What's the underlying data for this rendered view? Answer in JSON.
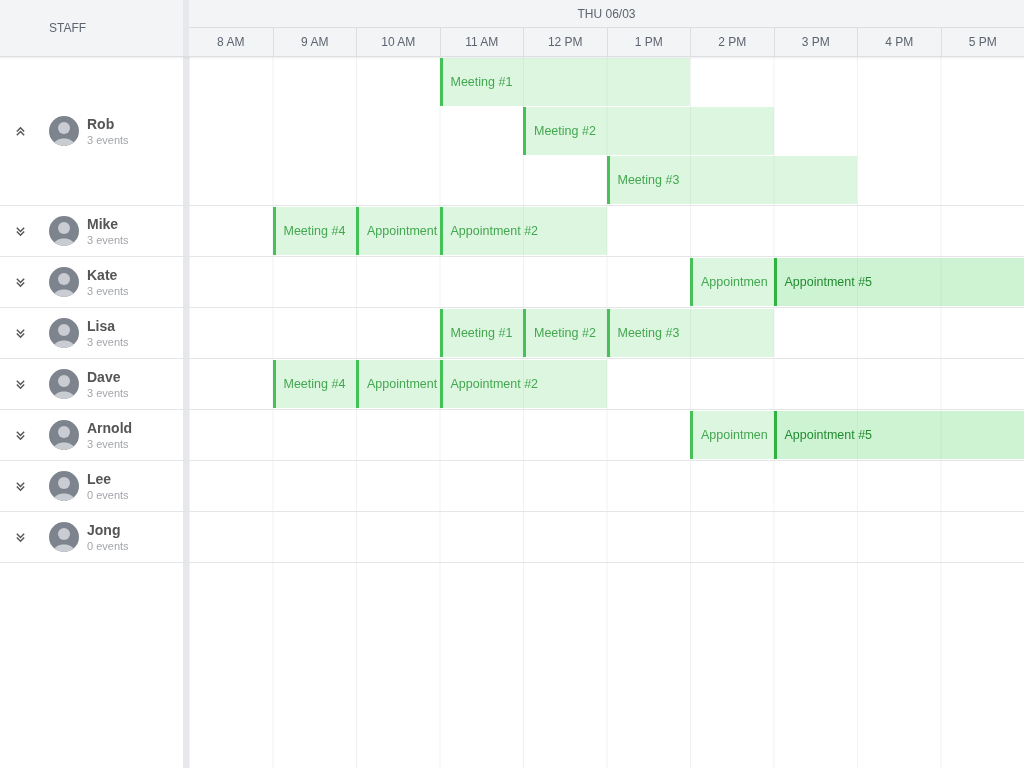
{
  "staff_header": "STAFF",
  "date": "THU 06/03",
  "hours": [
    "8 AM",
    "9 AM",
    "10 AM",
    "11 AM",
    "12 PM",
    "1 PM",
    "2 PM",
    "3 PM",
    "4 PM",
    "5 PM"
  ],
  "staff": [
    {
      "name": "Rob",
      "events_count": "3 events",
      "expanded": true,
      "lanes": [
        [
          {
            "kind": "empty"
          },
          {
            "kind": "empty"
          },
          {
            "kind": "empty"
          },
          {
            "kind": "event",
            "label": "Meeting #1",
            "highlighted": false
          },
          {
            "kind": "continued"
          },
          {
            "kind": "continued"
          },
          {
            "kind": "empty"
          },
          {
            "kind": "empty"
          },
          {
            "kind": "empty"
          },
          {
            "kind": "empty"
          }
        ],
        [
          {
            "kind": "empty"
          },
          {
            "kind": "empty"
          },
          {
            "kind": "empty"
          },
          {
            "kind": "empty"
          },
          {
            "kind": "event",
            "label": "Meeting #2",
            "highlighted": false
          },
          {
            "kind": "continued"
          },
          {
            "kind": "continued"
          },
          {
            "kind": "empty"
          },
          {
            "kind": "empty"
          },
          {
            "kind": "empty"
          }
        ],
        [
          {
            "kind": "empty"
          },
          {
            "kind": "empty"
          },
          {
            "kind": "empty"
          },
          {
            "kind": "empty"
          },
          {
            "kind": "empty"
          },
          {
            "kind": "event",
            "label": "Meeting #3",
            "highlighted": false
          },
          {
            "kind": "continued"
          },
          {
            "kind": "continued"
          },
          {
            "kind": "empty"
          },
          {
            "kind": "empty"
          }
        ]
      ]
    },
    {
      "name": "Mike",
      "events_count": "3 events",
      "expanded": false,
      "lanes": [
        [
          {
            "kind": "empty"
          },
          {
            "kind": "event",
            "label": "Meeting #4",
            "highlighted": false
          },
          {
            "kind": "event",
            "label": "Appointment",
            "highlighted": false
          },
          {
            "kind": "event",
            "label": "Appointment #2",
            "highlighted": false
          },
          {
            "kind": "continued"
          },
          {
            "kind": "empty"
          },
          {
            "kind": "empty"
          },
          {
            "kind": "empty"
          },
          {
            "kind": "empty"
          },
          {
            "kind": "empty"
          }
        ]
      ]
    },
    {
      "name": "Kate",
      "events_count": "3 events",
      "expanded": false,
      "lanes": [
        [
          {
            "kind": "empty"
          },
          {
            "kind": "empty"
          },
          {
            "kind": "empty"
          },
          {
            "kind": "empty"
          },
          {
            "kind": "empty"
          },
          {
            "kind": "empty"
          },
          {
            "kind": "event",
            "label": "Appointmen",
            "highlighted": false
          },
          {
            "kind": "event",
            "label": "Appointment #5",
            "highlighted": true
          },
          {
            "kind": "continued"
          },
          {
            "kind": "continued"
          }
        ]
      ]
    },
    {
      "name": "Lisa",
      "events_count": "3 events",
      "expanded": false,
      "lanes": [
        [
          {
            "kind": "empty"
          },
          {
            "kind": "empty"
          },
          {
            "kind": "empty"
          },
          {
            "kind": "event",
            "label": "Meeting #1",
            "highlighted": false
          },
          {
            "kind": "event",
            "label": "Meeting #2",
            "highlighted": false
          },
          {
            "kind": "event",
            "label": "Meeting #3",
            "highlighted": false
          },
          {
            "kind": "continued"
          },
          {
            "kind": "empty"
          },
          {
            "kind": "empty"
          },
          {
            "kind": "empty"
          }
        ]
      ]
    },
    {
      "name": "Dave",
      "events_count": "3 events",
      "expanded": false,
      "lanes": [
        [
          {
            "kind": "empty"
          },
          {
            "kind": "event",
            "label": "Meeting #4",
            "highlighted": false
          },
          {
            "kind": "event",
            "label": "Appointment",
            "highlighted": false
          },
          {
            "kind": "event",
            "label": "Appointment #2",
            "highlighted": false
          },
          {
            "kind": "continued"
          },
          {
            "kind": "empty"
          },
          {
            "kind": "empty"
          },
          {
            "kind": "empty"
          },
          {
            "kind": "empty"
          },
          {
            "kind": "empty"
          }
        ]
      ]
    },
    {
      "name": "Arnold",
      "events_count": "3 events",
      "expanded": false,
      "lanes": [
        [
          {
            "kind": "empty"
          },
          {
            "kind": "empty"
          },
          {
            "kind": "empty"
          },
          {
            "kind": "empty"
          },
          {
            "kind": "empty"
          },
          {
            "kind": "empty"
          },
          {
            "kind": "event",
            "label": "Appointmen",
            "highlighted": false
          },
          {
            "kind": "event",
            "label": "Appointment #5",
            "highlighted": true
          },
          {
            "kind": "continued"
          },
          {
            "kind": "continued"
          }
        ]
      ]
    },
    {
      "name": "Lee",
      "events_count": "0 events",
      "expanded": false
    },
    {
      "name": "Jong",
      "events_count": "0 events",
      "expanded": false
    }
  ]
}
